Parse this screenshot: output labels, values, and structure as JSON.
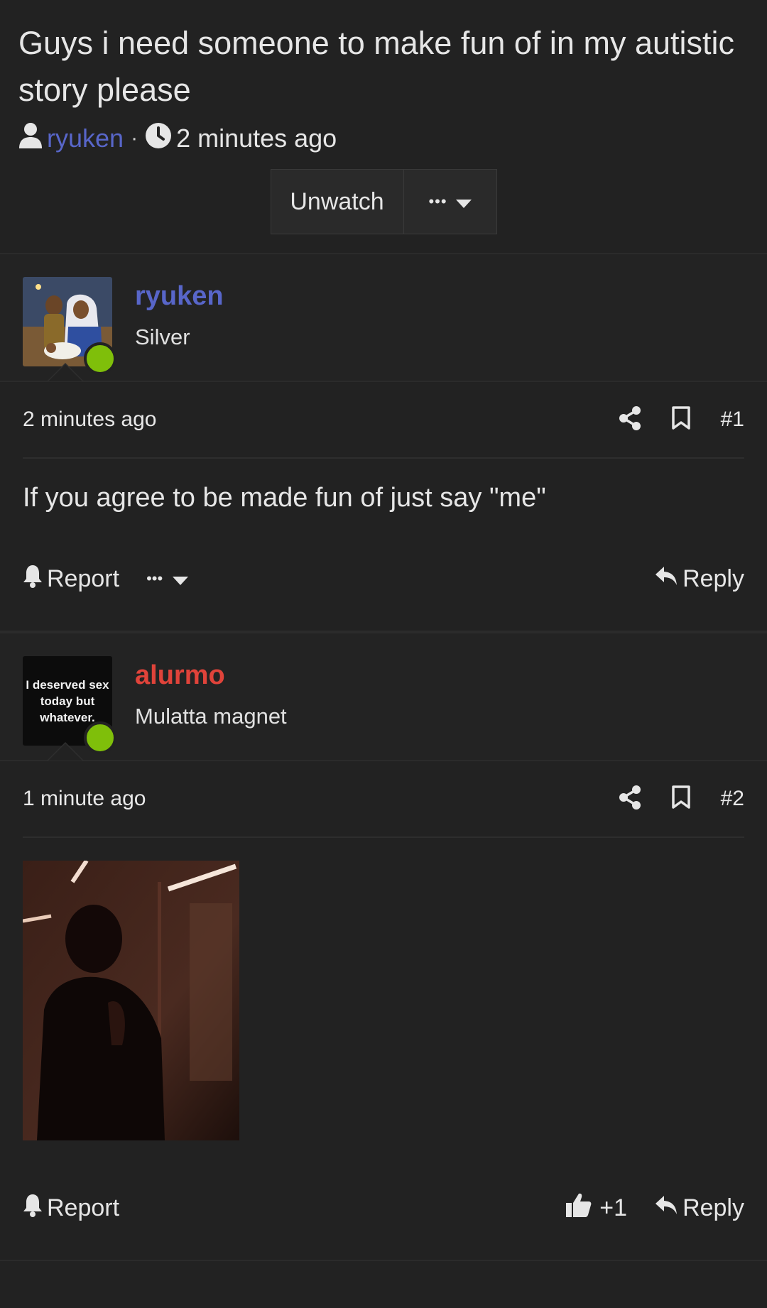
{
  "thread": {
    "title": "Guys i need someone to make fun of in my autistic story please",
    "author": "ryuken",
    "separator": "·",
    "time": "2 minutes ago"
  },
  "toolbar": {
    "unwatch_label": "Unwatch",
    "more_label": "•••"
  },
  "posts": [
    {
      "username": "ryuken",
      "username_color": "#5866c9",
      "user_title": "Silver",
      "time": "2 minutes ago",
      "number": "#1",
      "text": "If you agree to be made fun of just say \"me\"",
      "report_label": "Report",
      "more_label": "•••",
      "reply_label": "Reply"
    },
    {
      "username": "alurmo",
      "username_color": "#e0433a",
      "user_title": "Mulatta magnet",
      "avatar_text": "I deserved sex today but whatever.",
      "time": "1 minute ago",
      "number": "#2",
      "report_label": "Report",
      "like_count": "+1",
      "reply_label": "Reply"
    }
  ],
  "colors": {
    "background": "#222222",
    "link": "#5866c9",
    "online": "#7fbf0a"
  }
}
